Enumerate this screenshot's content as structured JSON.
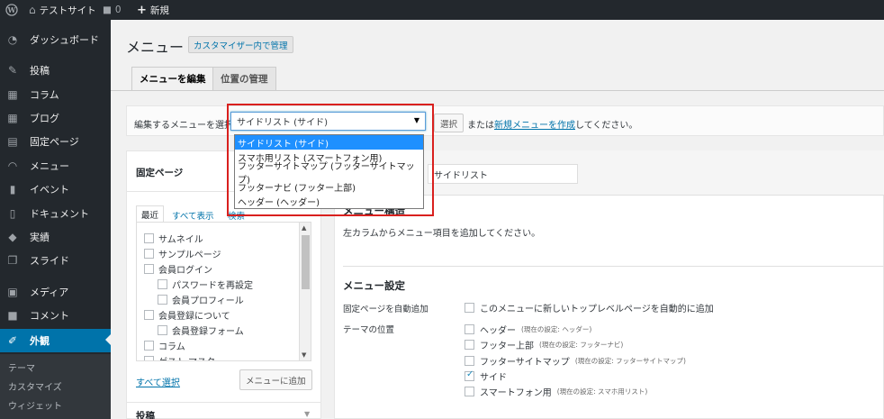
{
  "admin_bar": {
    "site_name": "テストサイト",
    "comments_count": "0",
    "new_label": "新規"
  },
  "sidebar": {
    "items": [
      {
        "label": "ダッシュボード",
        "icon": "dashboard-icon"
      },
      {
        "label": "投稿",
        "icon": "pushpin-icon"
      },
      {
        "label": "コラム",
        "icon": "table-icon"
      },
      {
        "label": "ブログ",
        "icon": "table-icon"
      },
      {
        "label": "固定ページ",
        "icon": "page-icon"
      },
      {
        "label": "メニュー",
        "icon": "gauge-icon"
      },
      {
        "label": "イベント",
        "icon": "book-icon"
      },
      {
        "label": "ドキュメント",
        "icon": "document-icon"
      },
      {
        "label": "実績",
        "icon": "tag-icon"
      },
      {
        "label": "スライド",
        "icon": "slides-icon"
      },
      {
        "label": "メディア",
        "icon": "media-icon"
      },
      {
        "label": "コメント",
        "icon": "comment-icon"
      },
      {
        "label": "外観",
        "icon": "brush-icon"
      }
    ],
    "submenu": [
      "テーマ",
      "カスタマイズ",
      "ウィジェット"
    ]
  },
  "header": {
    "title": "メニュー",
    "customizer_button": "カスタマイザー内で管理"
  },
  "tabs": [
    "メニューを編集",
    "位置の管理"
  ],
  "select_bar": {
    "label": "編集するメニューを選択",
    "selected": "サイドリスト (サイド)",
    "options": [
      "サイドリスト (サイド)",
      "スマホ用リスト (スマートフォン用)",
      "フッターサイトマップ (フッターサイトマップ)",
      "フッターナビ (フッター上部)",
      "ヘッダー (ヘッダー)"
    ],
    "select_button": "選択",
    "or_text": "または",
    "create_link": "新規メニューを作成",
    "suffix": "してください。"
  },
  "left_panel": {
    "title": "固定ページ",
    "subtabs": [
      "最近",
      "すべて表示",
      "検索"
    ],
    "pages": [
      {
        "label": "サムネイル",
        "indent": 0
      },
      {
        "label": "サンプルページ",
        "indent": 0
      },
      {
        "label": "会員ログイン",
        "indent": 0
      },
      {
        "label": "パスワードを再設定",
        "indent": 1
      },
      {
        "label": "会員プロフィール",
        "indent": 1
      },
      {
        "label": "会員登録について",
        "indent": 0
      },
      {
        "label": "会員登録フォーム",
        "indent": 1
      },
      {
        "label": "コラム",
        "indent": 0
      },
      {
        "label": "ゲスト マスク",
        "indent": 0
      }
    ],
    "select_all": "すべて選択",
    "add_button": "メニューに追加",
    "next_title": "投稿"
  },
  "right_panel": {
    "menu_name_value": "サイドリスト",
    "structure_title": "メニュー構造",
    "structure_hint": "左カラムからメニュー項目を追加してください。",
    "settings_title": "メニュー設定",
    "auto_add_label": "固定ページを自動追加",
    "auto_add_text": "このメニューに新しいトップレベルページを自動的に追加",
    "theme_location_label": "テーマの位置",
    "locations": [
      {
        "name": "ヘッダー",
        "note": "(現在の設定: ヘッダー)",
        "checked": false
      },
      {
        "name": "フッター上部",
        "note": "(現在の設定: フッターナビ)",
        "checked": false
      },
      {
        "name": "フッターサイトマップ",
        "note": "(現在の設定: フッターサイトマップ)",
        "checked": false
      },
      {
        "name": "サイド",
        "note": "",
        "checked": true
      },
      {
        "name": "スマートフォン用",
        "note": "(現在の設定: スマホ用リスト)",
        "checked": false
      }
    ]
  },
  "colors": {
    "admin_dark": "#23282d",
    "accent": "#0073aa",
    "highlight_red": "#d9201e",
    "option_highlight": "#1e90ff"
  }
}
